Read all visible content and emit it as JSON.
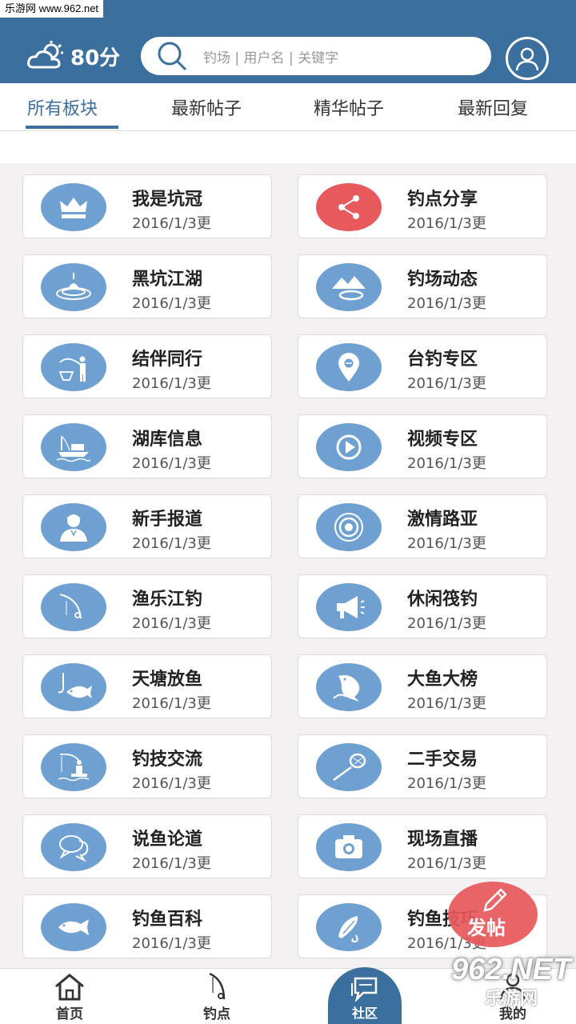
{
  "watermark": {
    "site": "乐游网 www.962.net",
    "logo": "962.NET",
    "logo_sub": "乐游网"
  },
  "header": {
    "weather_icon": "cloud-sun-icon",
    "score": "80分",
    "search_placeholder": "钓场 | 用户名 | 关键字",
    "avatar_icon": "user-icon"
  },
  "tabs": [
    {
      "label": "所有板块",
      "active": true
    },
    {
      "label": "最新帖子"
    },
    {
      "label": "精华帖子"
    },
    {
      "label": "最新回复"
    }
  ],
  "boards": [
    {
      "title": "我是坑冠",
      "date": "2016/1/3更",
      "icon": "crown-icon"
    },
    {
      "title": "钓点分享",
      "date": "2016/1/3更",
      "icon": "share-icon",
      "accent": "#e8595c"
    },
    {
      "title": "黑坑江湖",
      "date": "2016/1/3更",
      "icon": "float-ripple-icon"
    },
    {
      "title": "钓场动态",
      "date": "2016/1/3更",
      "icon": "mountain-lake-icon"
    },
    {
      "title": "结伴同行",
      "date": "2016/1/3更",
      "icon": "angler-icon"
    },
    {
      "title": "台钓专区",
      "date": "2016/1/3更",
      "icon": "location-pin-icon"
    },
    {
      "title": "湖库信息",
      "date": "2016/1/3更",
      "icon": "boat-icon"
    },
    {
      "title": "视频专区",
      "date": "2016/1/3更",
      "icon": "play-icon"
    },
    {
      "title": "新手报道",
      "date": "2016/1/3更",
      "icon": "person-icon"
    },
    {
      "title": "激情路亚",
      "date": "2016/1/3更",
      "icon": "target-icon"
    },
    {
      "title": "渔乐江钓",
      "date": "2016/1/3更",
      "icon": "fishing-rod-icon"
    },
    {
      "title": "休闲筏钓",
      "date": "2016/1/3更",
      "icon": "megaphone-icon"
    },
    {
      "title": "天塘放鱼",
      "date": "2016/1/3更",
      "icon": "fish-hook-icon"
    },
    {
      "title": "大鱼大榜",
      "date": "2016/1/3更",
      "icon": "jumping-fish-icon"
    },
    {
      "title": "钓技交流",
      "date": "2016/1/3更",
      "icon": "angler-water-icon"
    },
    {
      "title": "二手交易",
      "date": "2016/1/3更",
      "icon": "landing-net-icon"
    },
    {
      "title": "说鱼论道",
      "date": "2016/1/3更",
      "icon": "chat-bubbles-icon"
    },
    {
      "title": "现场直播",
      "date": "2016/1/3更",
      "icon": "camera-icon"
    },
    {
      "title": "钓鱼百科",
      "date": "2016/1/3更",
      "icon": "fish-icon"
    },
    {
      "title": "钓鱼技巧",
      "date": "2016/1/3更",
      "icon": "lure-icon"
    }
  ],
  "fab": {
    "label": "发帖",
    "icon": "pencil-icon"
  },
  "bottom_nav": [
    {
      "label": "首页",
      "icon": "home-icon"
    },
    {
      "label": "钓点",
      "icon": "rod-icon"
    },
    {
      "label": "社区",
      "icon": "community-chat-icon",
      "active": true
    },
    {
      "label": "我的",
      "icon": "user-icon"
    }
  ],
  "colors": {
    "primary": "#3b6f9d",
    "icon_blue": "#6fa0d2",
    "accent_red": "#e8595c"
  }
}
